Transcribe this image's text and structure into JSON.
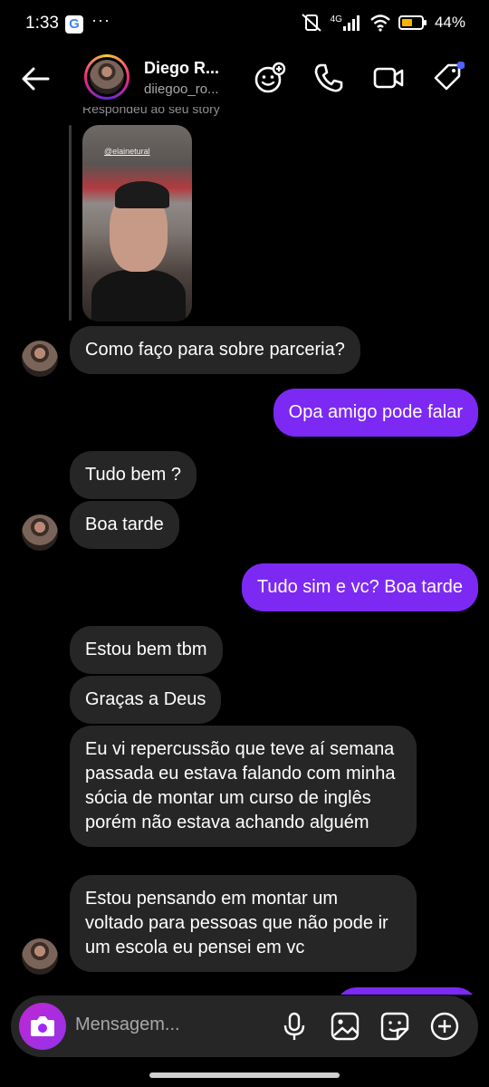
{
  "status_bar": {
    "time": "1:33",
    "google_badge": "G",
    "dots": "···",
    "network": "4G",
    "battery": "44%"
  },
  "header": {
    "name": "Diego  R...",
    "username": "diiegoo_ro...",
    "icons": [
      "effects-icon",
      "phone-icon",
      "video-icon",
      "tag-icon"
    ]
  },
  "chat": {
    "replied_label": "Respondeu ao seu story",
    "story_tag": "@elainetural",
    "messages": [
      {
        "dir": "in",
        "text": "Como faço para sobre parceria?"
      },
      {
        "dir": "out",
        "text": "Opa amigo pode falar"
      },
      {
        "dir": "in",
        "text": "Tudo bem ?"
      },
      {
        "dir": "in",
        "text": "Boa tarde"
      },
      {
        "dir": "out",
        "text": "Tudo sim e vc? Boa tarde"
      },
      {
        "dir": "in",
        "text": "Estou bem tbm"
      },
      {
        "dir": "in",
        "text": "Graças a Deus"
      },
      {
        "dir": "in",
        "text": "Eu vi repercussão que teve aí semana passada eu estava falando com minha sócia de montar um curso de inglês porém não estava achando alguém"
      },
      {
        "dir": "in",
        "text": "Estou pensando em montar um voltado para pessoas que não pode ir um escola eu pensei em vc"
      }
    ]
  },
  "composer": {
    "placeholder": "Mensagem..."
  },
  "colors": {
    "outgoing_bubble": "#7c29f4",
    "incoming_bubble": "#262626",
    "camera_button": "#a125ff",
    "background": "#000000"
  }
}
